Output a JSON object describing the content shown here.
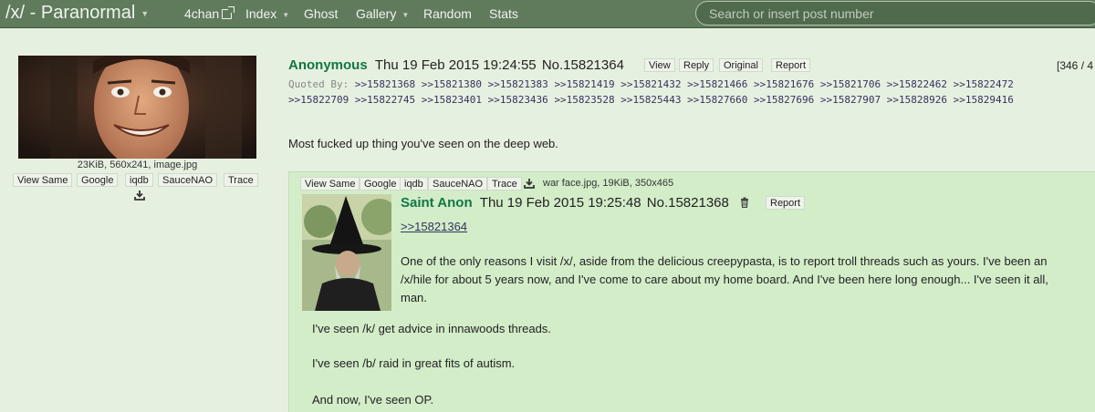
{
  "nav": {
    "board_title": "/x/ - Paranormal",
    "links": [
      "4chan",
      "Index",
      "Ghost",
      "Gallery",
      "Random",
      "Stats"
    ],
    "search_placeholder": "Search or insert post number"
  },
  "op": {
    "name": "Anonymous",
    "date": "Thu 19 Feb 2015 19:24:55",
    "post_no": "No.15821364",
    "actions": [
      "View",
      "Reply",
      "Original",
      "Report"
    ],
    "page_counter": "[346 / 4",
    "quoted_by_label": "Quoted By:",
    "quoted_by": [
      ">>15821368",
      ">>15821380",
      ">>15821383",
      ">>15821419",
      ">>15821432",
      ">>15821466",
      ">>15821676",
      ">>15821706",
      ">>15822462",
      ">>15822472",
      ">>15822709",
      ">>15822745",
      ">>15823401",
      ">>15823436",
      ">>15823528",
      ">>15825443",
      ">>15827660",
      ">>15827696",
      ">>15827907",
      ">>15828926",
      ">>15829416"
    ],
    "comment": "Most fucked up thing you've seen on the deep web.",
    "file_meta": "23KiB, 560x241, image.jpg",
    "image_buttons": [
      "View Same",
      "Google",
      "iqdb",
      "SauceNAO",
      "Trace"
    ]
  },
  "reply": {
    "image_buttons": [
      "View Same",
      "Google",
      "iqdb",
      "SauceNAO",
      "Trace"
    ],
    "file_info": "war face.jpg, 19KiB, 350x465",
    "name": "Saint Anon",
    "date": "Thu 19 Feb 2015 19:25:48",
    "post_no": "No.15821368",
    "report": "Report",
    "quote_link": ">>15821364",
    "paragraph_lines": [
      "One of the only reasons I visit /x/, aside from the delicious creepypasta, is to report troll threads such as yours. I've been an",
      "/x/hile for about 5 years now, and I've come to care about my home board. And I've been here long enough... I've seen it all,",
      "man."
    ],
    "lines": [
      "I've seen /k/ get advice in innawoods threads.",
      "I've seen /b/ raid in great fits of autism.",
      "And now, I've seen OP."
    ]
  },
  "colors": {
    "navbar": "#5f7b5c",
    "background": "#e6f0e0",
    "reply_background": "#d3edc9",
    "name_green": "#117743",
    "link_blue": "#34345c"
  }
}
